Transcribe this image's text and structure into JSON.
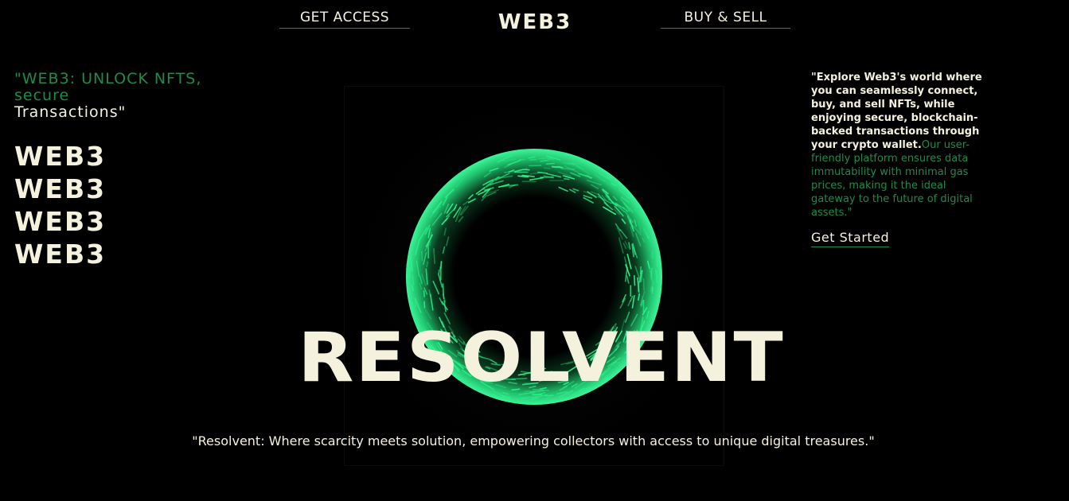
{
  "nav": {
    "left_link": "GET ACCESS",
    "logo": "WEB3",
    "right_link": "BUY & SELL"
  },
  "tagline": {
    "line_green": "\"WEB3: UNLOCK NFTS, secure",
    "line_cream": "Transactions\""
  },
  "stack": [
    "WEB3",
    "WEB3",
    "WEB3",
    "WEB3"
  ],
  "description": {
    "strong": "\"Explore Web3's world where you can seamlessly connect, buy, and sell NFTs, while enjoying secure, blockchain-backed transactions through your crypto wallet.",
    "muted": "Our user-friendly platform ensures data immutability with minimal gas prices, making it the ideal gateway to the future of digital assets.\""
  },
  "cta_label": "Get Started",
  "hero": {
    "title": "RESOLVENT",
    "quote": "\"Resolvent: Where scarcity meets solution, empowering collectors with access to unique digital treasures.\""
  },
  "colors": {
    "background": "#000000",
    "text": "#f4f1dc",
    "accent": "#1f8a4c",
    "orb_glow": "#2bf08a"
  },
  "icons": {
    "orb": "glowing-sphere"
  }
}
